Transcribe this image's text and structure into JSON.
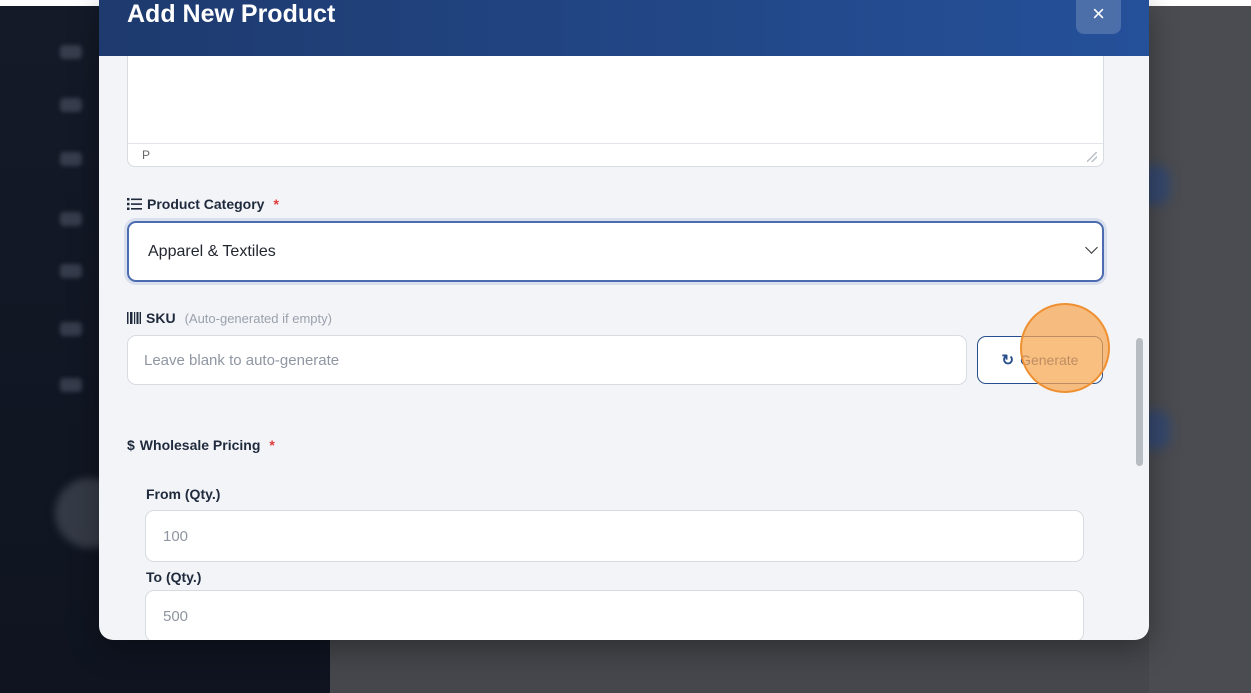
{
  "modal": {
    "title": "Add New Product",
    "close_label": "×"
  },
  "editor": {
    "path_label": "P"
  },
  "category": {
    "icon": "list-icon",
    "label": "Product Category",
    "required_mark": "*",
    "selected_value": "Apparel & Textiles"
  },
  "sku": {
    "icon": "barcode-icon",
    "label": "SKU",
    "hint": "(Auto-generated if empty)",
    "placeholder": "Leave blank to auto-generate",
    "generate_label": "Generate",
    "generate_icon": "refresh-icon"
  },
  "pricing": {
    "icon": "dollar-icon",
    "label": "Wholesale Pricing",
    "required_mark": "*",
    "from_label": "From (Qty.)",
    "from_placeholder": "100",
    "to_label": "To (Qty.)",
    "to_placeholder": "500"
  },
  "colors": {
    "header_start": "#1e3a6e",
    "header_end": "#25519a",
    "accent": "#284d8c",
    "required": "#e03b3b",
    "click_highlight": "#f7a650"
  }
}
